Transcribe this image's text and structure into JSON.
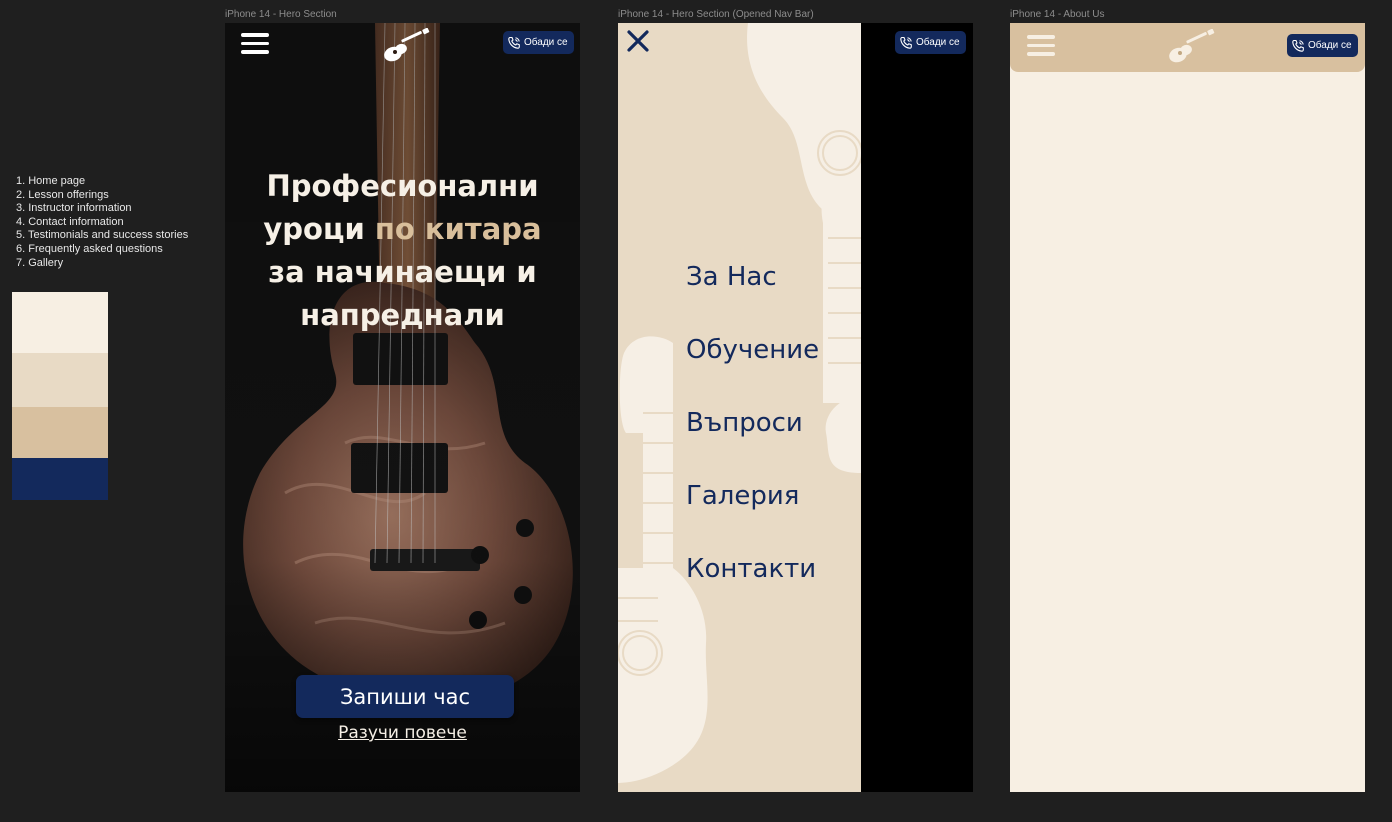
{
  "frame_labels": {
    "hero": "iPhone 14 - Hero Section",
    "nav": "iPhone 14 - Hero Section (Opened Nav Bar)",
    "about": "iPhone 14 - About Us"
  },
  "sitemap": [
    "1. Home page",
    "2. Lesson offerings",
    "3. Instructor information",
    "4. Contact information",
    "5. Testimonials and success stories",
    "6. Frequently asked questions",
    "7. Gallery"
  ],
  "palette": [
    "#f7efe3",
    "#e8dac5",
    "#d8c09f",
    "#13295c"
  ],
  "header": {
    "call_label": "Обади се",
    "menu_icon": "hamburger-icon",
    "logo_icon": "guitar-logo-icon",
    "phone_icon": "phone-icon"
  },
  "hero": {
    "title_line1": "Професионални",
    "title_line2_a": "уроци",
    "title_line2_b": " по китара",
    "title_line3": "за начинаещи и",
    "title_line4": "напреднали",
    "cta_primary": "Запиши час",
    "cta_secondary": "Разучи повече"
  },
  "nav": {
    "close_icon": "close-icon",
    "items": [
      "За Нас",
      "Обучение",
      "Въпроси",
      "Галерия",
      "Контакти"
    ]
  },
  "colors": {
    "cream": "#f7efe3",
    "sand": "#e8dac5",
    "tan": "#d8c09f",
    "navy": "#13295c",
    "hero_accent": "#d9bf9b"
  }
}
